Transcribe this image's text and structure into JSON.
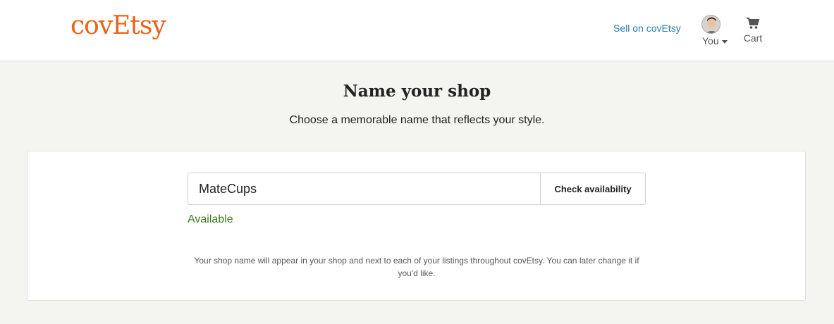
{
  "header": {
    "logo": "covEtsy",
    "sell_link": "Sell on covEtsy",
    "user_label": "You",
    "cart_label": "Cart",
    "icons": {
      "avatar": "user-avatar",
      "cart": "cart-icon",
      "caret": "caret-down-icon"
    }
  },
  "main": {
    "title": "Name your shop",
    "subtitle": "Choose a memorable name that reflects your style."
  },
  "form": {
    "shop_name_value": "MateCups",
    "check_button": "Check availability",
    "status": "Available",
    "help_text": "Your shop name will appear in your shop and next to each of your listings throughout covEtsy. You can later change it if you'd like."
  },
  "colors": {
    "brand": "#e8641c",
    "link": "#2a7fa8",
    "available": "#3d7b1f",
    "background": "#f4f4f0"
  }
}
